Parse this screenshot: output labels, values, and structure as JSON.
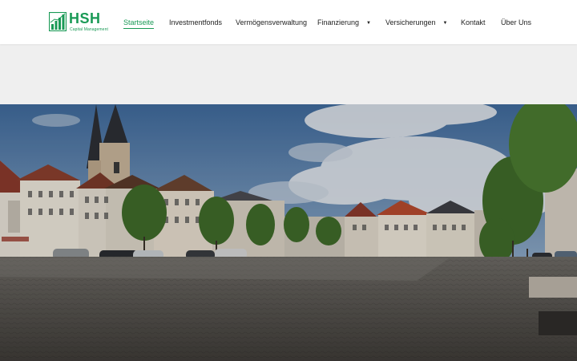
{
  "brand": {
    "name": "HSH",
    "tagline": "Capital Management",
    "logo_icon": "bar-chart-logo",
    "accent_color": "#1a9a56"
  },
  "nav": {
    "items": [
      {
        "label": "Startseite",
        "active": true,
        "has_dropdown": false
      },
      {
        "label": "Investmentfonds",
        "active": false,
        "has_dropdown": false
      },
      {
        "label": "Vermögensverwaltung",
        "active": false,
        "has_dropdown": false
      },
      {
        "label": "Finanzierung",
        "active": false,
        "has_dropdown": true,
        "dropdown_icon": "caret-down-icon"
      },
      {
        "label": "Versicherungen",
        "active": false,
        "has_dropdown": true,
        "dropdown_icon": "caret-down-icon"
      },
      {
        "label": "Kontakt",
        "active": false,
        "has_dropdown": false
      },
      {
        "label": "Über Uns",
        "active": false,
        "has_dropdown": false
      }
    ]
  },
  "hero": {
    "image": "town-square-panorama"
  }
}
